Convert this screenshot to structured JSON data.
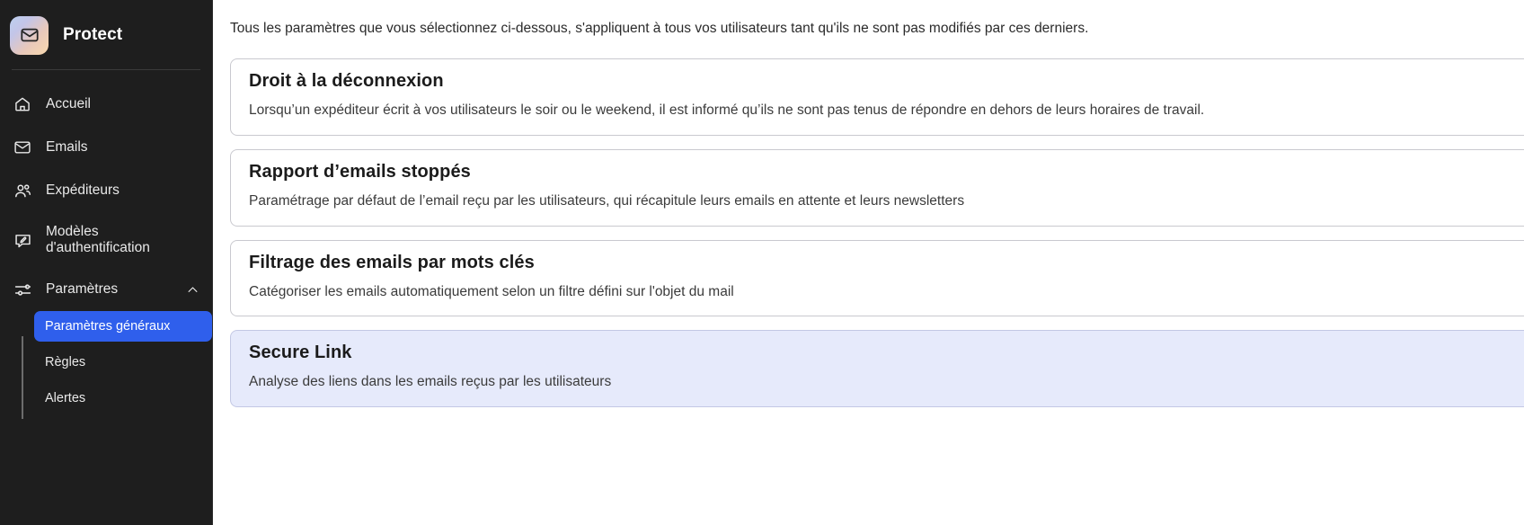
{
  "sidebar": {
    "brand": {
      "name": "Protect",
      "logo_icon": "envelope-icon"
    },
    "items": [
      {
        "label": "Accueil",
        "icon": "home-icon"
      },
      {
        "label": "Emails",
        "icon": "envelope-icon"
      },
      {
        "label": "Expéditeurs",
        "icon": "users-icon"
      },
      {
        "label": "Modèles d'authentification",
        "icon": "message-pencil-icon"
      },
      {
        "label": "Paramètres",
        "icon": "sliders-icon",
        "chevron": "chevron-up-icon",
        "expanded": true
      }
    ],
    "submenu": [
      {
        "label": "Paramètres généraux",
        "active": true
      },
      {
        "label": "Règles",
        "active": false
      },
      {
        "label": "Alertes",
        "active": false
      }
    ],
    "colors": {
      "background": "#1e1e1e",
      "active_item": "#2f5fec",
      "text": "#e9e9e9"
    }
  },
  "main": {
    "intro": "Tous les paramètres que vous sélectionnez ci-dessous, s'appliquent à tous vos utilisateurs tant qu'ils ne sont pas modifiés par ces derniers.",
    "cards": [
      {
        "title": "Droit à la déconnexion",
        "description": "Lorsqu’un expéditeur écrit à vos utilisateurs le soir ou le weekend, il est informé qu’ils ne sont pas tenus de répondre en dehors de leurs horaires de travail.",
        "selected": false
      },
      {
        "title": "Rapport d’emails stoppés",
        "description": "Paramétrage par défaut de l’email reçu par les utilisateurs, qui récapitule leurs emails en attente et leurs newsletters",
        "selected": false
      },
      {
        "title": "Filtrage des emails par mots clés",
        "description": "Catégoriser les emails automatiquement selon un filtre défini sur l'objet du mail",
        "selected": false
      },
      {
        "title": "Secure Link",
        "description": "Analyse des liens dans les emails reçus par les utilisateurs",
        "selected": true
      }
    ],
    "colors": {
      "card_border": "#c9c9cf",
      "card_selected_bg": "#e6eafb"
    }
  }
}
